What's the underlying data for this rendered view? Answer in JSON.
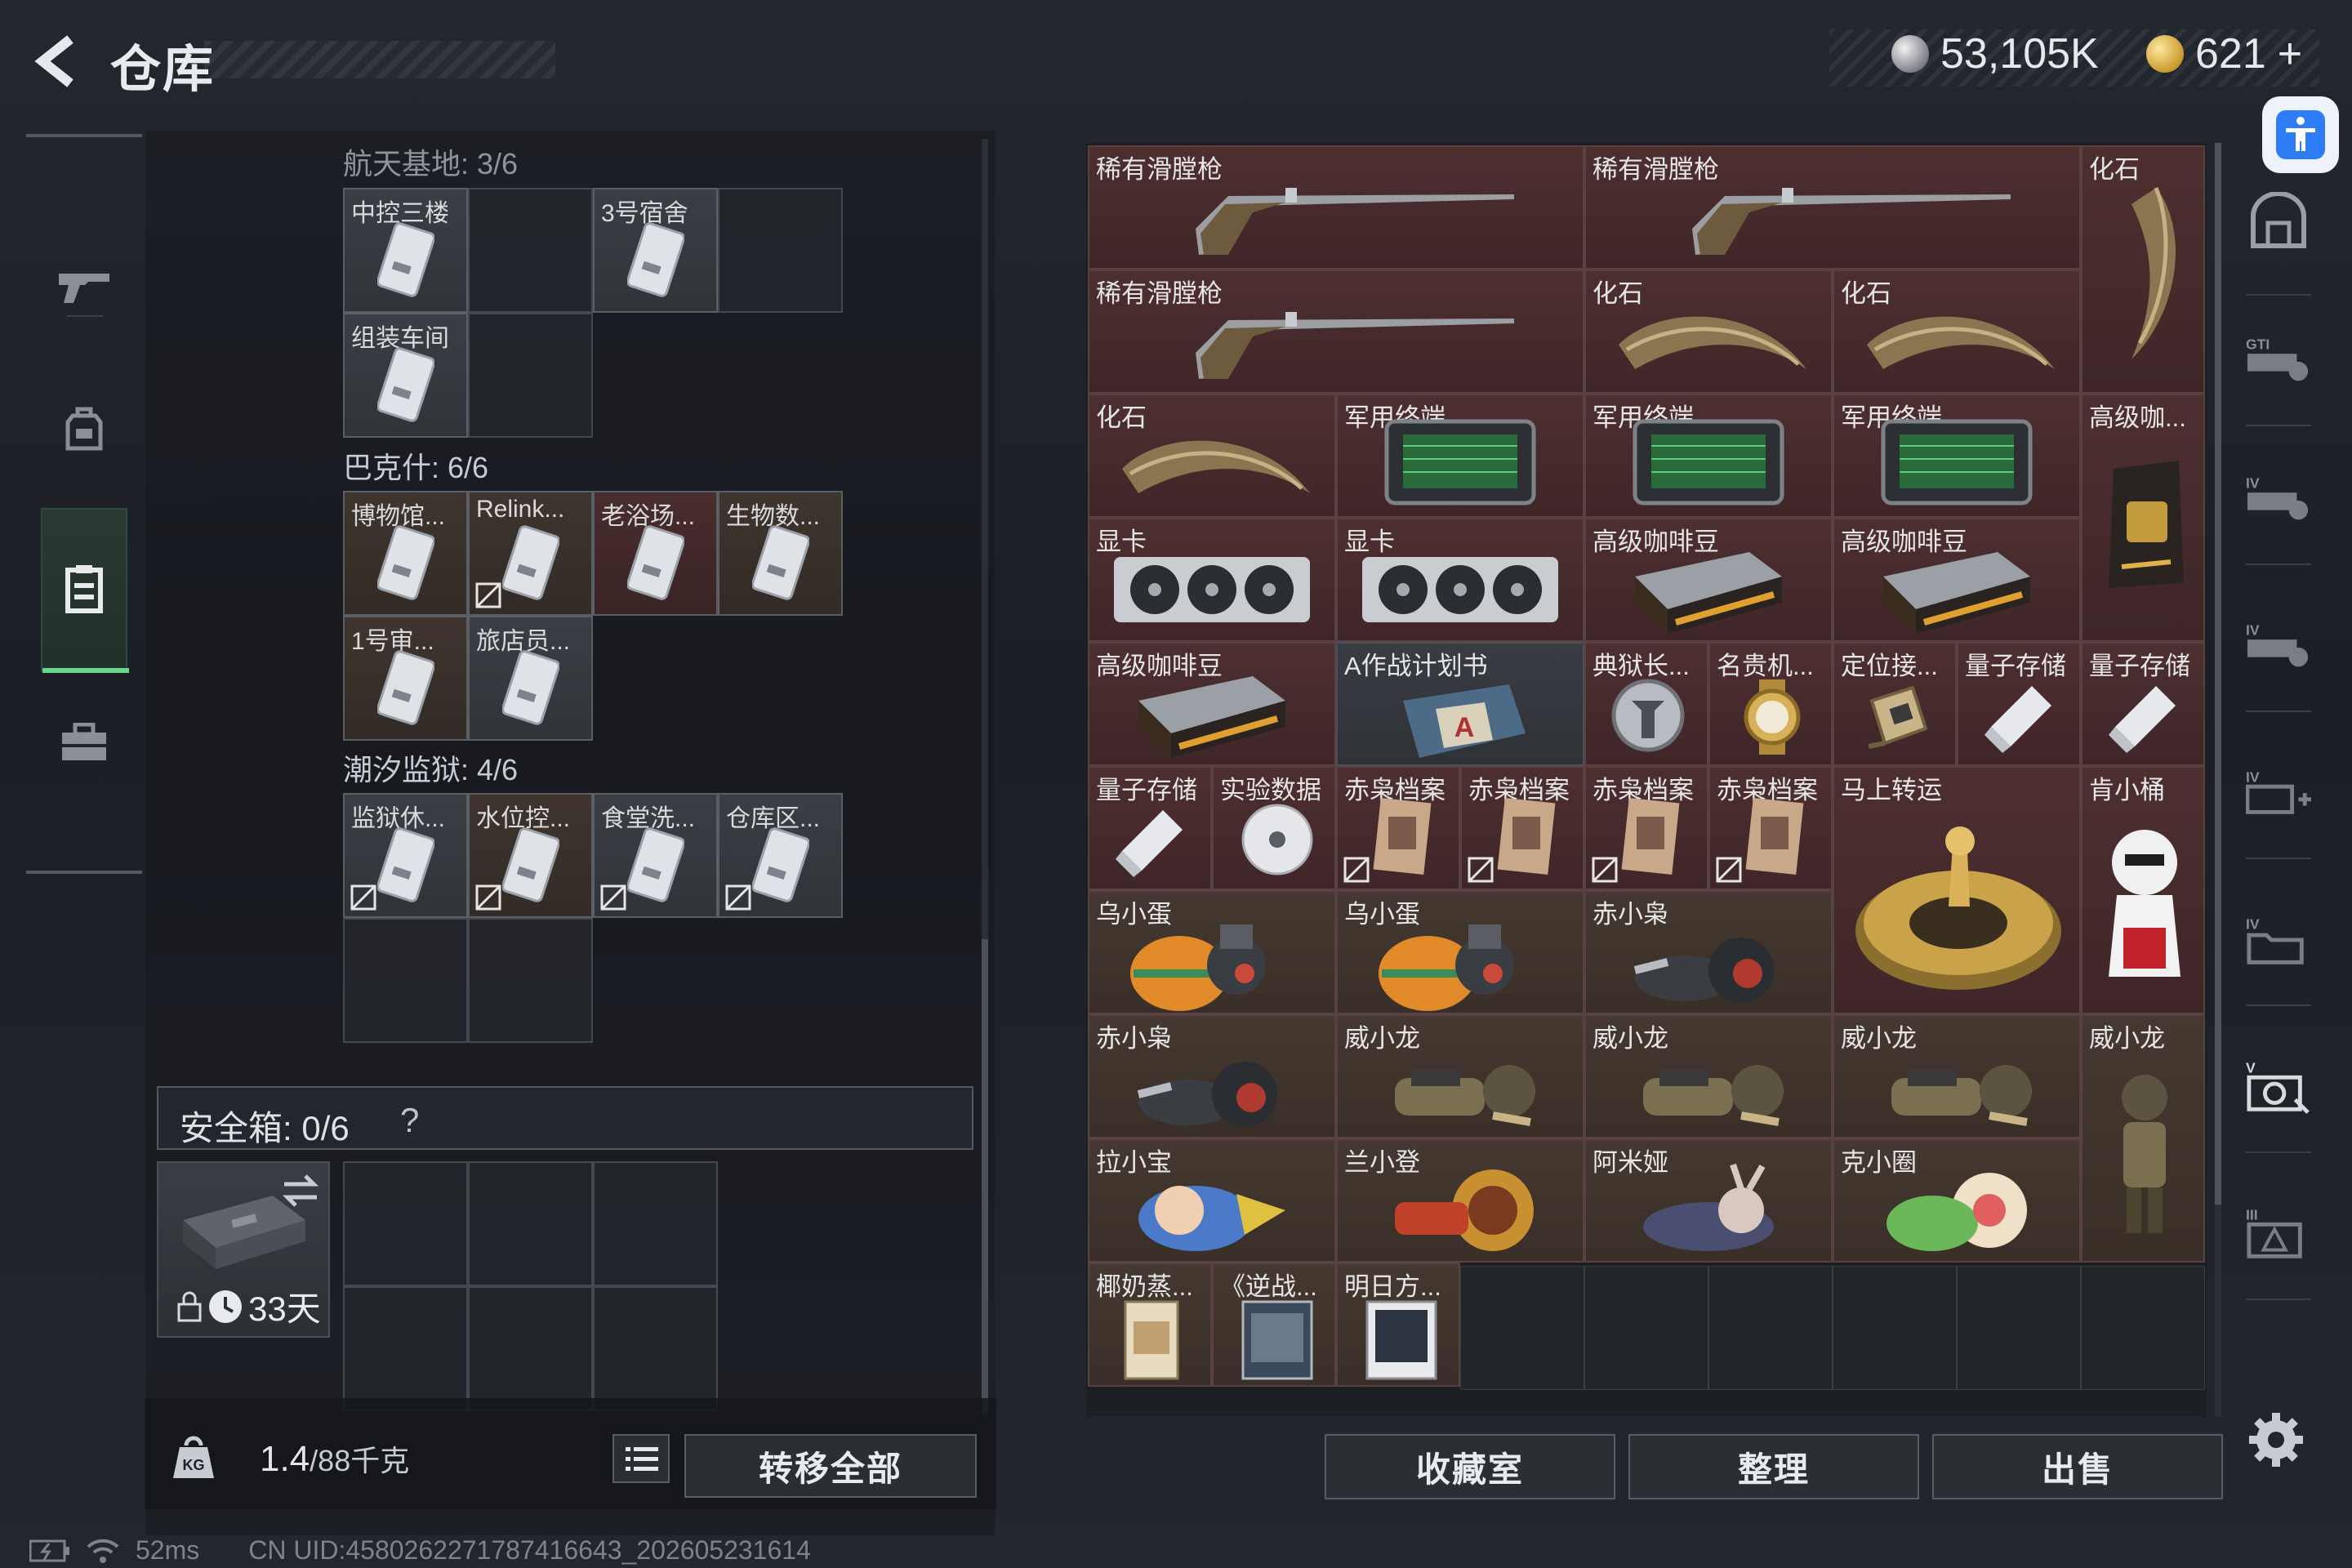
{
  "header": {
    "title": "仓库",
    "silver_amount": "53,105K",
    "gold_amount": "621",
    "gold_plus": "+"
  },
  "left_nav": {
    "items": [
      {
        "name": "gun-icon",
        "active": false
      },
      {
        "name": "backpack-icon",
        "active": false
      },
      {
        "name": "container-icon",
        "active": true
      },
      {
        "name": "briefcase-icon",
        "active": false
      }
    ]
  },
  "storage": {
    "sections": [
      {
        "label": "航天基地: 3/6",
        "items": [
          "中控三楼",
          "3号宿舍",
          "组装车间"
        ]
      },
      {
        "label": "巴克什: 6/6",
        "items": [
          "博物馆...",
          "Relink...",
          "老浴场...",
          "生物数...",
          "1号审...",
          "旅店员..."
        ]
      },
      {
        "label": "潮汐监狱: 4/6",
        "items": [
          "监狱休...",
          "水位控...",
          "食堂洗...",
          "仓库区..."
        ]
      }
    ],
    "safebox_label": "安全箱: 0/6",
    "safebox_help": "?",
    "safebox_days": "33天",
    "weight_value": "1.4",
    "weight_capacity": "/88千克",
    "transfer_all": "转移全部"
  },
  "status": {
    "ping": "52ms",
    "uid": "CN UID:458026227178741664​3_202605231614"
  },
  "inventory": {
    "items": [
      {
        "label": "稀有滑膛枪",
        "icon": "musket-icon"
      },
      {
        "label": "稀有滑膛枪",
        "icon": "musket-icon"
      },
      {
        "label": "化石",
        "icon": "claw-fossil-icon"
      },
      {
        "label": "稀有滑膛枪",
        "icon": "musket-icon"
      },
      {
        "label": "化石",
        "icon": "claw-fossil-icon"
      },
      {
        "label": "化石",
        "icon": "claw-fossil-icon"
      },
      {
        "label": "化石",
        "icon": "claw-fossil-icon"
      },
      {
        "label": "军用终端",
        "icon": "terminal-icon"
      },
      {
        "label": "军用终端",
        "icon": "terminal-icon"
      },
      {
        "label": "军用终端",
        "icon": "terminal-icon"
      },
      {
        "label": "高级咖...",
        "icon": "coffee-bag-icon"
      },
      {
        "label": "显卡",
        "icon": "gpu-icon"
      },
      {
        "label": "显卡",
        "icon": "gpu-icon"
      },
      {
        "label": "高级咖啡豆",
        "icon": "coffee-box-icon"
      },
      {
        "label": "高级咖啡豆",
        "icon": "coffee-box-icon"
      },
      {
        "label": "高级咖啡豆",
        "icon": "coffee-box-icon"
      },
      {
        "label": "A作战计划书",
        "icon": "plan-case-icon"
      },
      {
        "label": "典狱长...",
        "icon": "badge-icon"
      },
      {
        "label": "名贵机...",
        "icon": "watch-icon"
      },
      {
        "label": "定位接...",
        "icon": "receiver-icon"
      },
      {
        "label": "量子存储",
        "icon": "usb-icon"
      },
      {
        "label": "量子存储",
        "icon": "usb-icon"
      },
      {
        "label": "量子存储",
        "icon": "usb-icon"
      },
      {
        "label": "实验数据",
        "icon": "disc-icon"
      },
      {
        "label": "赤枭档案",
        "icon": "file-icon"
      },
      {
        "label": "赤枭档案",
        "icon": "file-icon"
      },
      {
        "label": "赤枭档案",
        "icon": "file-icon"
      },
      {
        "label": "赤枭档案",
        "icon": "file-icon"
      },
      {
        "label": "马上转运",
        "icon": "wheel-icon"
      },
      {
        "label": "肯小桶",
        "icon": "figure-icon"
      },
      {
        "label": "乌小蛋",
        "icon": "figure-icon"
      },
      {
        "label": "乌小蛋",
        "icon": "figure-icon"
      },
      {
        "label": "赤小枭",
        "icon": "figure-icon"
      },
      {
        "label": "赤小枭",
        "icon": "figure-icon"
      },
      {
        "label": "威小龙",
        "icon": "figure-icon"
      },
      {
        "label": "威小龙",
        "icon": "figure-icon"
      },
      {
        "label": "威小龙",
        "icon": "figure-icon"
      },
      {
        "label": "威小龙",
        "icon": "figure-icon"
      },
      {
        "label": "拉小宝",
        "icon": "figure-icon"
      },
      {
        "label": "兰小登",
        "icon": "figure-icon"
      },
      {
        "label": "阿米娅",
        "icon": "figure-icon"
      },
      {
        "label": "克小圈",
        "icon": "figure-icon"
      },
      {
        "label": "椰奶蒸...",
        "icon": "book-icon"
      },
      {
        "label": "《逆战...",
        "icon": "book-icon"
      },
      {
        "label": "明日方...",
        "icon": "book-icon"
      }
    ],
    "buttons": {
      "collection": "收藏室",
      "organize": "整理",
      "sell": "出售"
    }
  },
  "colors": {
    "accent_green": "#66d68e",
    "rarity_red": "#4e2f30",
    "rarity_gold": "#443830",
    "rarity_grey": "#393c42"
  }
}
